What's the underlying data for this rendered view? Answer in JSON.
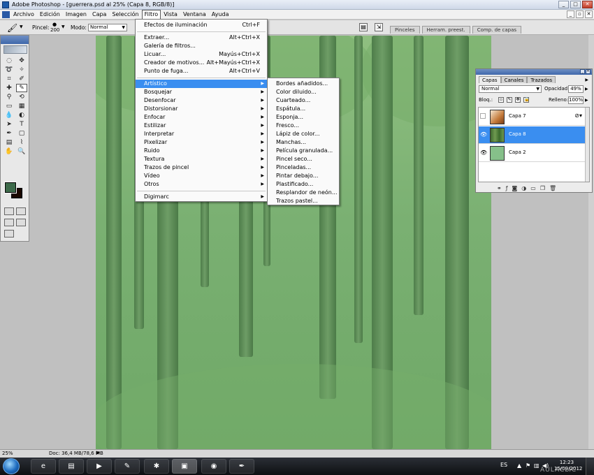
{
  "window": {
    "title": "Adobe Photoshop - [guerrera.psd al 25% (Capa 8, RGB/8)]",
    "min": "_",
    "max": "□",
    "close": "✕"
  },
  "menubar": {
    "items": [
      "Archivo",
      "Edición",
      "Imagen",
      "Capa",
      "Selección",
      "Filtro",
      "Vista",
      "Ventana",
      "Ayuda"
    ],
    "active": "Filtro",
    "doc_btns": [
      "_",
      "▫",
      "✕"
    ]
  },
  "options": {
    "pincel_label": "Pincel:",
    "pincel_size": "200",
    "modo_label": "Modo:",
    "modo_value": "Normal"
  },
  "palette_well": {
    "tabs": [
      "Pinceles",
      "Herram. preest.",
      "Comp. de capas"
    ]
  },
  "filtro_menu": {
    "top": [
      {
        "label": "Efectos de iluminación",
        "shortcut": "Ctrl+F"
      }
    ],
    "group2": [
      {
        "label": "Extraer...",
        "shortcut": "Alt+Ctrl+X"
      },
      {
        "label": "Galería de filtros...",
        "shortcut": ""
      },
      {
        "label": "Licuar...",
        "shortcut": "Mayús+Ctrl+X"
      },
      {
        "label": "Creador de motivos...",
        "shortcut": "Alt+Mayús+Ctrl+X"
      },
      {
        "label": "Punto de fuga...",
        "shortcut": "Alt+Ctrl+V"
      }
    ],
    "submenus": [
      "Artístico",
      "Bosquejar",
      "Desenfocar",
      "Distorsionar",
      "Enfocar",
      "Estilizar",
      "Interpretar",
      "Pixelizar",
      "Ruido",
      "Textura",
      "Trazos de pincel",
      "Vídeo",
      "Otros"
    ],
    "highlighted": "Artístico",
    "bottom": [
      "Digimarc"
    ]
  },
  "artistico_menu": {
    "items": [
      "Bordes añadidos...",
      "Color diluido...",
      "Cuarteado...",
      "Espátula...",
      "Esponja...",
      "Fresco...",
      "Lápiz de color...",
      "Manchas...",
      "Película granulada...",
      "Pincel seco...",
      "Pinceladas...",
      "Pintar debajo...",
      "Plastificado...",
      "Resplandor de neón...",
      "Trazos pastel..."
    ]
  },
  "layers_panel": {
    "tabs": [
      "Capas",
      "Canales",
      "Trazados"
    ],
    "active_tab": "Capas",
    "blend_mode": "Normal",
    "opacity_label": "Opacidad:",
    "opacity_value": "49%",
    "lock_label": "Bloq.:",
    "fill_label": "Relleno:",
    "fill_value": "100%",
    "layers": [
      {
        "name": "Capa 7",
        "visible": false,
        "selected": false,
        "thumb": "#c47a3a",
        "has_fx": true
      },
      {
        "name": "Capa 8",
        "visible": true,
        "selected": true,
        "thumb": "#5e8a45",
        "has_fx": false
      },
      {
        "name": "Capa 2",
        "visible": true,
        "selected": false,
        "thumb": "#86c08a",
        "has_fx": false
      }
    ]
  },
  "status": {
    "zoom": "25%",
    "doc": "Doc: 36,4 MB/78,6 MB"
  },
  "taskbar": {
    "lang": "ES",
    "time": "12:23",
    "date": "15/09/2012"
  },
  "watermark": "AULACLIC",
  "colors": {
    "foreground": "#3d6a4a",
    "background": "#1a0700",
    "highlight": "#3a8ef0"
  }
}
